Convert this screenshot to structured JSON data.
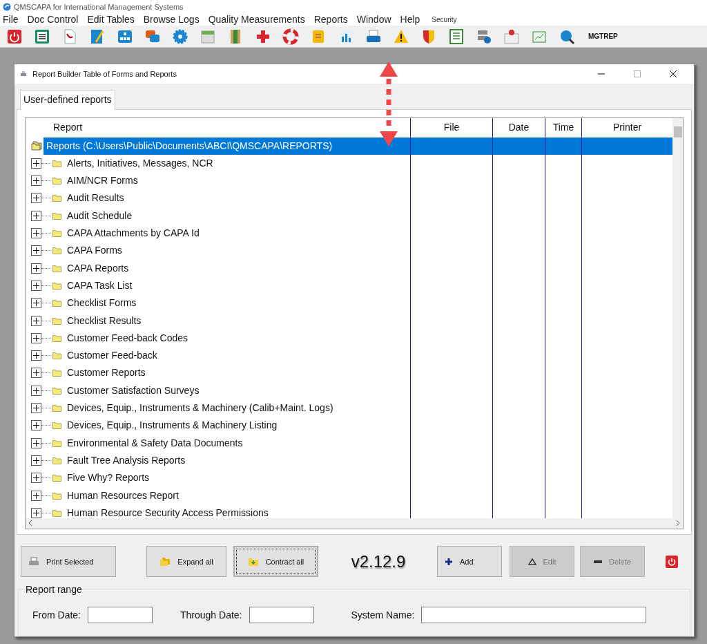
{
  "app_title": "QMSCAPA for International Management Systems",
  "menu": [
    {
      "label": "File"
    },
    {
      "label": "Doc Control"
    },
    {
      "label": "Edit Tables"
    },
    {
      "label": "Browse Logs"
    },
    {
      "label": "Quality Measurements"
    },
    {
      "label": "Reports"
    },
    {
      "label": "Window"
    },
    {
      "label": "Help"
    },
    {
      "label": "Security",
      "kind": "small"
    }
  ],
  "toolbar_text": "MGTREP",
  "dialog": {
    "title": "Report Builder Table of Forms and Reports",
    "tabs": [
      {
        "label": "User-defined reports",
        "selected": true
      }
    ],
    "columns": [
      "Report",
      "File",
      "Date",
      "Time",
      "Printer"
    ],
    "root": {
      "label": "Reports (C:\\Users\\Public\\Documents\\ABCI\\QMSCAPA\\REPORTS)",
      "selected": true,
      "expanded": true,
      "children": [
        {
          "label": "Alerts, Initiatives, Messages, NCR",
          "expanded": false,
          "selected": false
        },
        {
          "label": "AIM/NCR Forms",
          "expanded": false,
          "selected": false
        },
        {
          "label": "Audit Results",
          "expanded": false,
          "selected": false
        },
        {
          "label": "Audit Schedule",
          "expanded": false,
          "selected": false
        },
        {
          "label": "CAPA Attachments by CAPA Id",
          "expanded": false,
          "selected": false
        },
        {
          "label": "CAPA Forms",
          "expanded": false,
          "selected": false
        },
        {
          "label": "CAPA Reports",
          "expanded": false,
          "selected": false
        },
        {
          "label": "CAPA Task List",
          "expanded": false,
          "selected": false
        },
        {
          "label": "Checklist Forms",
          "expanded": false,
          "selected": false
        },
        {
          "label": "Checklist Results",
          "expanded": false,
          "selected": false
        },
        {
          "label": "Customer Feed-back Codes",
          "expanded": false,
          "selected": false
        },
        {
          "label": "Customer Feed-back",
          "expanded": false,
          "selected": false
        },
        {
          "label": "Customer Reports",
          "expanded": false,
          "selected": false
        },
        {
          "label": "Customer Satisfaction Surveys",
          "expanded": false,
          "selected": false
        },
        {
          "label": "Devices, Equip., Instruments & Machinery (Calib+Maint. Logs)",
          "expanded": false,
          "selected": false
        },
        {
          "label": "Devices, Equip., Instruments & Machinery Listing",
          "expanded": false,
          "selected": false
        },
        {
          "label": "Environmental & Safety Data Documents",
          "expanded": false,
          "selected": false
        },
        {
          "label": "Fault Tree Analysis Reports",
          "expanded": false,
          "selected": false
        },
        {
          "label": "Five Why? Reports",
          "expanded": false,
          "selected": false
        },
        {
          "label": "Human Resources Report",
          "expanded": false,
          "selected": false
        },
        {
          "label": "Human Resource Security Access Permissions",
          "expanded": false,
          "selected": false
        }
      ]
    },
    "buttons": [
      {
        "kind": "print",
        "label": "Print Selected",
        "disabled": false,
        "focused": false
      },
      {
        "kind": "expand",
        "label": "Expand all",
        "disabled": false,
        "focused": false
      },
      {
        "kind": "contract",
        "label": "Contract all",
        "disabled": false,
        "focused": true
      },
      {
        "kind": "version",
        "label": "v2.12.9"
      },
      {
        "kind": "add",
        "label": "Add",
        "disabled": false,
        "focused": false
      },
      {
        "kind": "edit",
        "label": "Edit",
        "disabled": true,
        "focused": false
      },
      {
        "kind": "delete",
        "label": "Delete",
        "disabled": true,
        "focused": false
      },
      {
        "kind": "power"
      }
    ],
    "range": {
      "title": "Report range",
      "fields": [
        {
          "label": "From Date:"
        },
        {
          "label": "Through Date:"
        },
        {
          "label": "System Name:"
        }
      ]
    }
  }
}
